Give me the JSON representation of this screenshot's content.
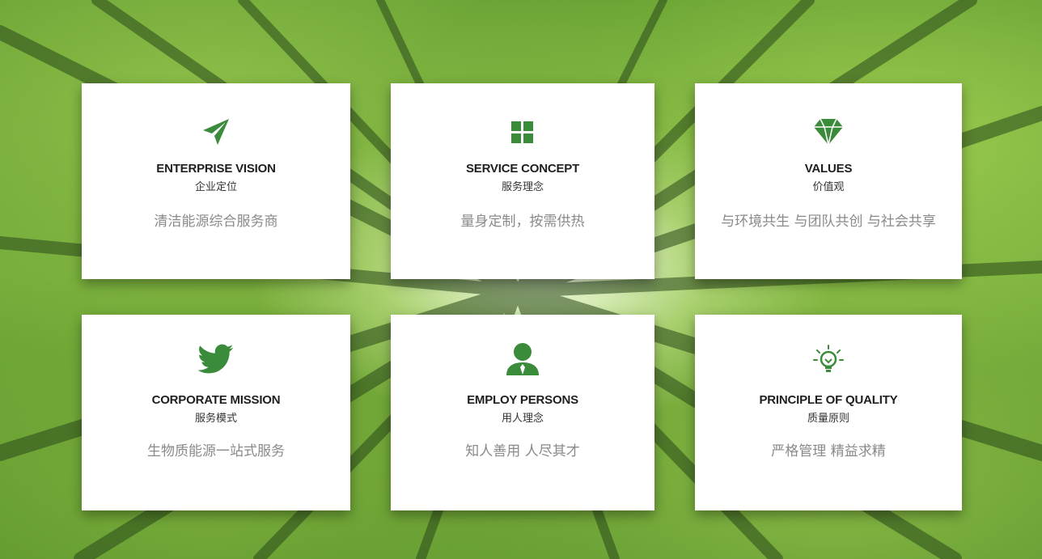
{
  "accent_color": "#3a8b3a",
  "cards": [
    {
      "icon": "paper-plane-icon",
      "title": "ENTERPRISE VISION",
      "subtitle": "企业定位",
      "desc": "清洁能源综合服务商"
    },
    {
      "icon": "grid-squares-icon",
      "title": "SERVICE  CONCEPT",
      "subtitle": "服务理念",
      "desc": "量身定制，按需供热"
    },
    {
      "icon": "diamond-icon",
      "title": "VALUES",
      "subtitle": "价值观",
      "desc": "与环境共生 与团队共创 与社会共享"
    },
    {
      "icon": "twitter-bird-icon",
      "title": "CORPORATE MISSION",
      "subtitle": "服务模式",
      "desc": "生物质能源一站式服务"
    },
    {
      "icon": "person-icon",
      "title": "EMPLOY PERSONS",
      "subtitle": "用人理念",
      "desc": "知人善用 人尽其才"
    },
    {
      "icon": "light-bulb-icon",
      "title": "PRINCIPLE OF QUALITY",
      "subtitle": "质量原则",
      "desc": "严格管理 精益求精"
    }
  ]
}
